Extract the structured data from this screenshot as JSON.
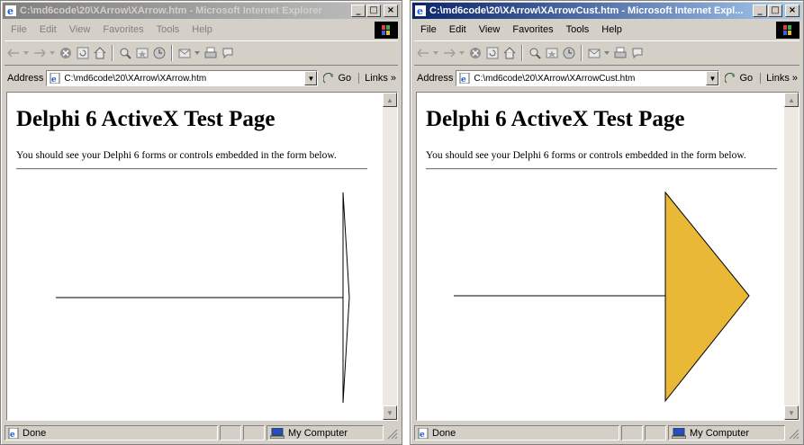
{
  "windows": [
    {
      "title": "C:\\md6code\\20\\XArrow\\XArrow.htm - Microsoft Internet Explorer",
      "menu": [
        "File",
        "Edit",
        "View",
        "Favorites",
        "Tools",
        "Help"
      ],
      "address_label": "Address",
      "address": "C:\\md6code\\20\\XArrow\\XArrow.htm",
      "go_label": "Go",
      "links_label": "Links »",
      "page_title": "Delphi 6 ActiveX Test Page",
      "page_text": "You should see your Delphi 6 forms or controls embedded in the form below.",
      "arrow_fill": "none",
      "status": "Done",
      "zone": "My Computer"
    },
    {
      "title": "C:\\md6code\\20\\XArrow\\XArrowCust.htm - Microsoft Internet Expl...",
      "menu": [
        "File",
        "Edit",
        "View",
        "Favorites",
        "Tools",
        "Help"
      ],
      "address_label": "Address",
      "address": "C:\\md6code\\20\\XArrow\\XArrowCust.htm",
      "go_label": "Go",
      "links_label": "Links »",
      "page_title": "Delphi 6 ActiveX Test Page",
      "page_text": "You should see your Delphi 6 forms or controls embedded in the form below.",
      "arrow_fill": "#e8b836",
      "status": "Done",
      "zone": "My Computer"
    }
  ],
  "colors": {
    "active_title": "#0a246a",
    "inactive_title": "#808080",
    "chrome": "#d4d0c8"
  }
}
